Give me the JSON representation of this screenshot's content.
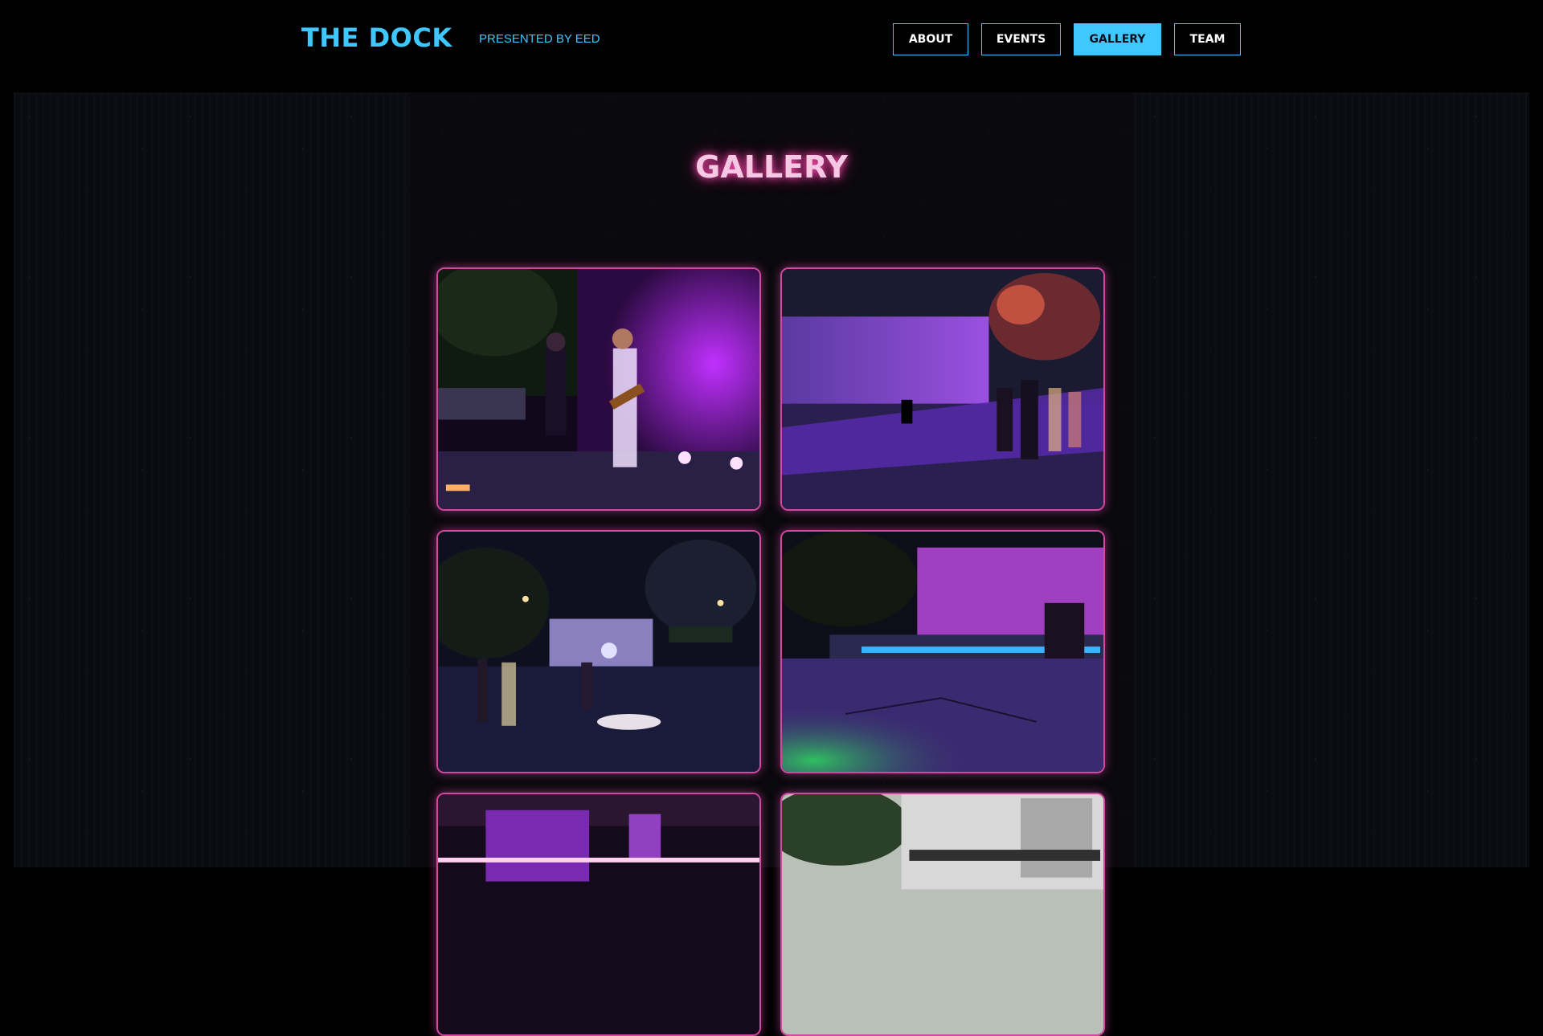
{
  "header": {
    "brand": "THE DOCK",
    "tagline": "PRESENTED BY EED",
    "nav": [
      {
        "label": "ABOUT",
        "active": false
      },
      {
        "label": "EVENTS",
        "active": false
      },
      {
        "label": "GALLERY",
        "active": true
      },
      {
        "label": "TEAM",
        "active": false
      }
    ]
  },
  "main": {
    "title": "GALLERY",
    "photos": [
      {
        "subject": "band-performing-stage"
      },
      {
        "subject": "crowd-at-outdoor-stage"
      },
      {
        "subject": "wide-view-stage-and-tables"
      },
      {
        "subject": "empty-lit-stage"
      },
      {
        "subject": "stage-lights-closeup"
      },
      {
        "subject": "stage-daytime"
      }
    ]
  },
  "colors": {
    "accent": "#3fc8ff",
    "title_glow": "#ff4fb0",
    "photo_border": "#d04aa0",
    "background": "#000000"
  }
}
